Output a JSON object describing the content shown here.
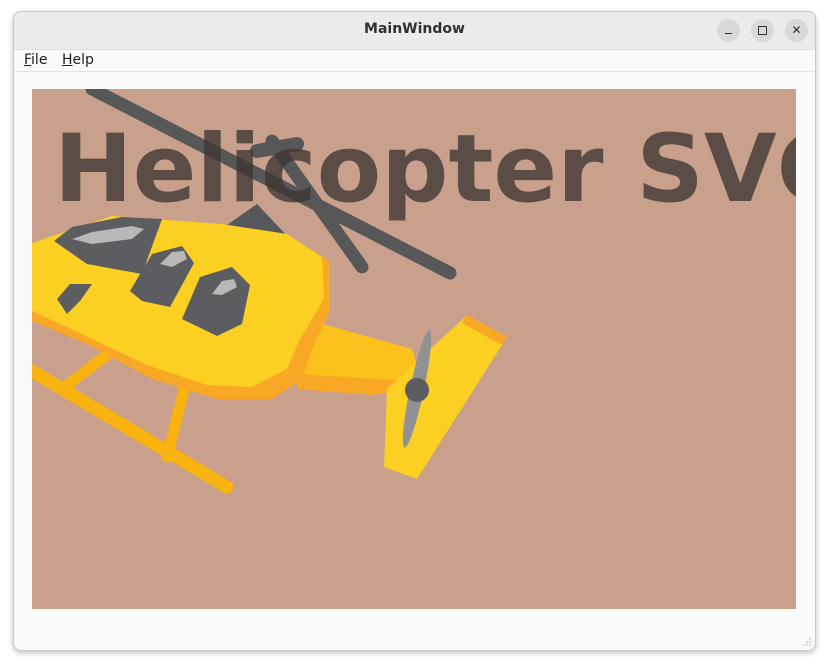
{
  "window": {
    "title": "MainWindow",
    "controls": {
      "minimize_icon": "minimize-icon",
      "maximize_icon": "maximize-icon",
      "close_glyph": "✕"
    }
  },
  "menubar": {
    "items": [
      {
        "mnemonic": "F",
        "rest": "ile"
      },
      {
        "mnemonic": "H",
        "rest": "elp"
      }
    ]
  },
  "content": {
    "heading": "Helicopter SVG",
    "background_color": "#c8a08b",
    "illustration": "helicopter-illustration"
  }
}
